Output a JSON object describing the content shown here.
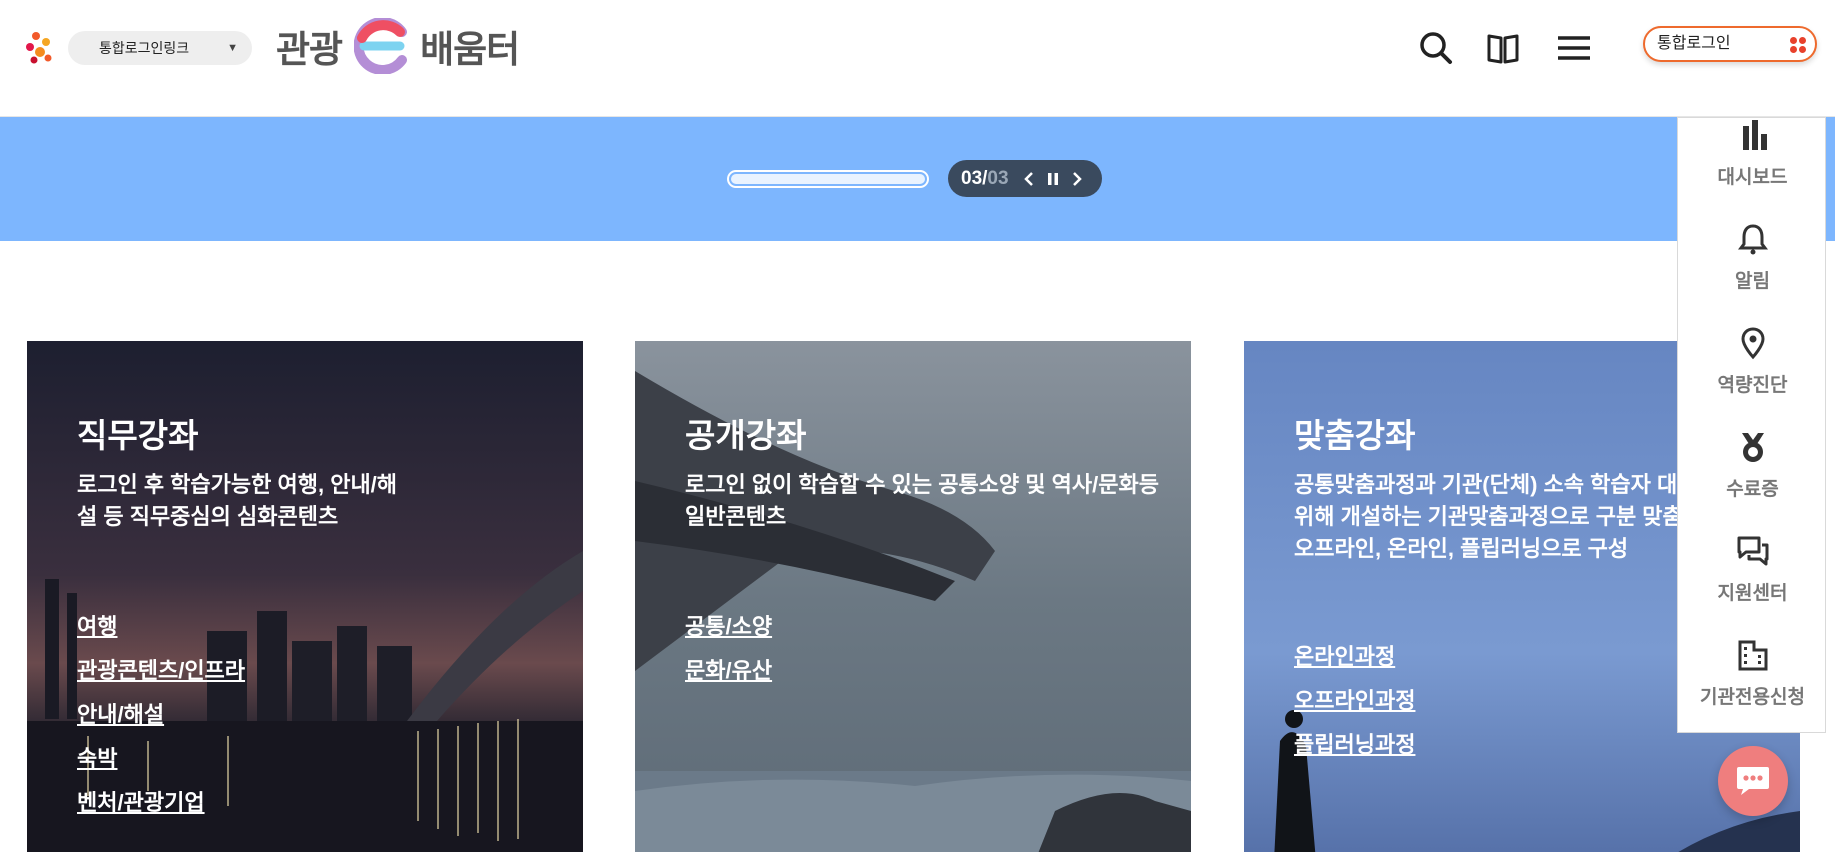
{
  "header": {
    "login_link_label": "통합로그인링크",
    "brand_left": "관광",
    "brand_right": "배움터",
    "login_button_label": "통합로그인"
  },
  "icons": {
    "search": "search-icon",
    "book": "book-icon",
    "menu": "hamburger-menu-icon",
    "chat": "chat-icon"
  },
  "banner": {
    "current": "03",
    "separator": "/",
    "total": "03",
    "progress": 1.0,
    "color": "#7db6fe"
  },
  "cards": [
    {
      "title": "직무강좌",
      "desc": "로그인 후 학습가능한 여행, 안내/해\n설 등 직무중심의 심화콘텐츠",
      "links": [
        "여행",
        "관광콘텐츠/인프라",
        "안내/해설",
        "숙박",
        "벤처/관광기업"
      ]
    },
    {
      "title": "공개강좌",
      "desc": "로그인 없이 학습할 수 있는 공통소양 및 역사/문화등\n일반콘텐츠",
      "links": [
        "공통/소양",
        "문화/유산"
      ]
    },
    {
      "title": "맞춤강좌",
      "desc": "공통맞춤과정과 기관(단체) 소속 학습자 대\n위해 개설하는 기관맞춤과정으로 구분 맞춤\n오프라인, 온라인, 플립러닝으로 구성",
      "links": [
        "온라인과정",
        "오프라인과정",
        "플립러닝과정"
      ]
    }
  ],
  "quick_menu": [
    {
      "label": "대시보드",
      "icon": "bar-chart-icon"
    },
    {
      "label": "알림",
      "icon": "bell-icon"
    },
    {
      "label": "역량진단",
      "icon": "location-pin-icon"
    },
    {
      "label": "수료증",
      "icon": "medal-icon"
    },
    {
      "label": "지원센터",
      "icon": "chat-bubbles-icon"
    },
    {
      "label": "기관전용신청",
      "icon": "building-icon"
    }
  ],
  "colors": {
    "accent_orange": "#ee6a2d",
    "card1_bg": "#232538",
    "card2_bg": "#6f7b86",
    "card3_bg": "#6a8bc6",
    "chat_fab": "#ef7e7e"
  }
}
